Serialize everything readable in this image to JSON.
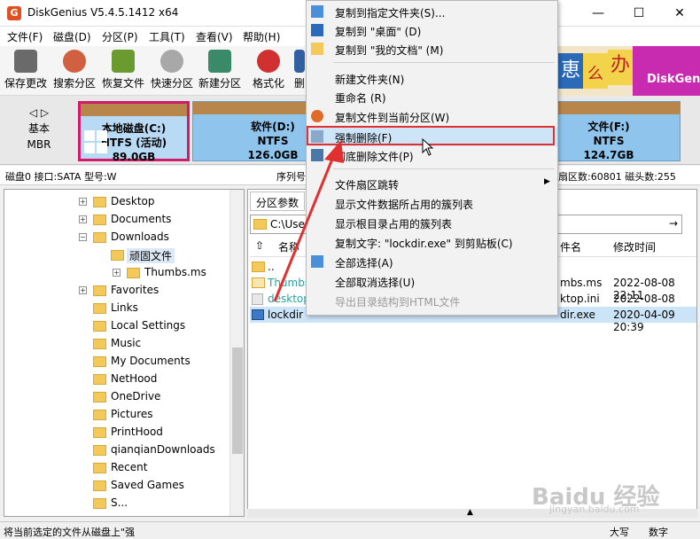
{
  "window": {
    "title": "DiskGenius V5.4.5.1412 x64",
    "min": "—",
    "max": "☐",
    "close": "✕"
  },
  "menu": [
    "文件(F)",
    "磁盘(D)",
    "分区(P)",
    "工具(T)",
    "查看(V)",
    "帮助(H)"
  ],
  "toolbar": [
    "保存更改",
    "搜索分区",
    "恢复文件",
    "快速分区",
    "新建分区",
    "格式化",
    "删"
  ],
  "banner": {
    "char1": "恵",
    "char2": "么",
    "char3": "办",
    "brand": "DiskGen"
  },
  "disk": {
    "line1": "基本",
    "line2": "MBR"
  },
  "partitions": [
    {
      "name": "本地磁盘(C:)",
      "fs": "NTFS (活动)",
      "size": "89.0GB"
    },
    {
      "name": "软件(D:)",
      "fs": "NTFS",
      "size": "126.0GB"
    },
    {
      "name": "文件(F:)",
      "fs": "NTFS",
      "size": "124.7GB"
    }
  ],
  "infobar": {
    "left": "磁盘0 接口:SATA  型号:W",
    "mid": "序列号",
    "right": "扇区数:60801  磁头数:255"
  },
  "tree": [
    "Desktop",
    "Documents",
    "Downloads",
    "顽固文件",
    "Thumbs.ms",
    "Favorites",
    "Links",
    "Local Settings",
    "Music",
    "My Documents",
    "NetHood",
    "OneDrive",
    "Pictures",
    "PrintHood",
    "qianqianDownloads",
    "Recent",
    "Saved Games",
    "S..."
  ],
  "right": {
    "tab": "分区参数",
    "path": "C:\\Use",
    "col_name": "名称",
    "col_short": "件名",
    "col_modified": "修改时间",
    "files": [
      {
        "name": "..",
        "short": "",
        "time": ""
      },
      {
        "name": "Thumbs",
        "short": "mbs.ms",
        "time": "2022-08-08 22:11"
      },
      {
        "name": "desktop",
        "short": "ktop.ini",
        "time": "2022-08-08 22:11"
      },
      {
        "name": "lockdir",
        "short": "dir.exe",
        "time": "2020-04-09 20:39"
      }
    ]
  },
  "context_menu": [
    "复制到指定文件夹(S)...",
    "复制到 \"桌面\" (D)",
    "复制到 \"我的文档\" (M)",
    "新建文件夹(N)",
    "重命名 (R)",
    "复制文件到当前分区(W)",
    "强制删除(F)",
    "彻底删除文件(P)",
    "文件扇区跳转",
    "显示文件数据所占用的簇列表",
    "显示根目录占用的簇列表",
    "复制文字: \"lockdir.exe\" 到剪贴板(C)",
    "全部选择(A)",
    "全部取消选择(U)",
    "导出目录结构到HTML文件"
  ],
  "status": {
    "left": "将当前选定的文件从磁盘上\"强",
    "caps": "大写",
    "num": "数字"
  },
  "watermark": {
    "main": "Baidu 经验",
    "sub": "jingyan.baidu.com"
  },
  "colors": {
    "accent": "#d01a6a",
    "highlight": "#e03030",
    "partition": "#8fc4ec"
  }
}
